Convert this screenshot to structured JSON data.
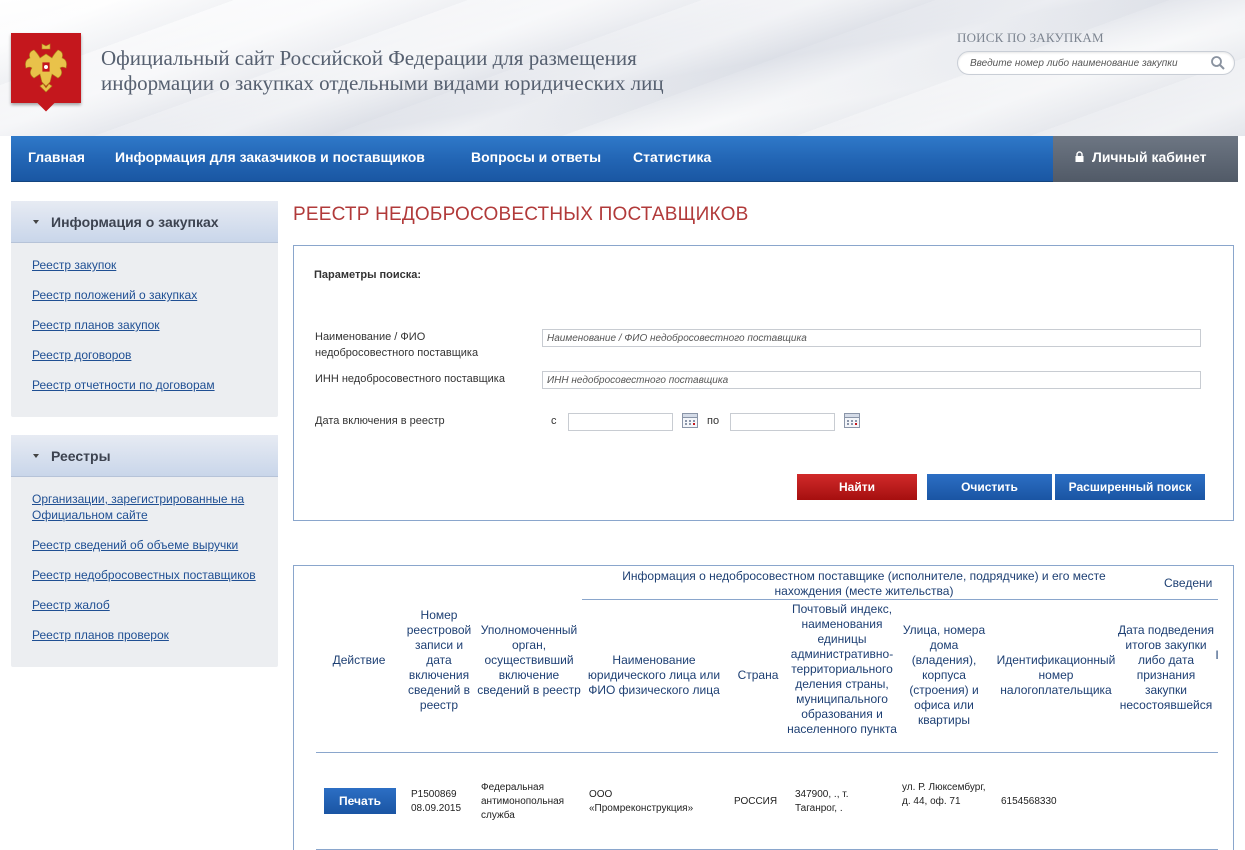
{
  "header": {
    "site_title": "Официальный сайт Российской Федерации для размещения информации о закупках отдельными видами юридических лиц",
    "search_label": "ПОИСК ПО ЗАКУПКАМ",
    "search_placeholder": "Введите номер либо наименование закупки"
  },
  "nav": {
    "items": [
      "Главная",
      "Информация для заказчиков и поставщиков",
      "Вопросы и ответы",
      "Статистика"
    ],
    "cabinet": "Личный кабинет"
  },
  "sidebar": {
    "blocks": [
      {
        "title": "Информация о закупках",
        "links": [
          "Реестр закупок",
          "Реестр положений о закупках",
          "Реестр планов закупок",
          "Реестр договоров",
          "Реестр отчетности по договорам"
        ]
      },
      {
        "title": "Реестры",
        "links": [
          "Организации, зарегистрированные на Официальном сайте",
          "Реестр сведений об объеме выручки",
          "Реестр недобросовестных поставщиков",
          "Реестр жалоб",
          "Реестр планов проверок"
        ]
      }
    ]
  },
  "main": {
    "page_title": "РЕЕСТР НЕДОБРОСОВЕСТНЫХ ПОСТАВЩИКОВ",
    "search": {
      "params_label": "Параметры поиска:",
      "name_label": "Наименование / ФИО недобросовестного поставщика",
      "name_placeholder": "Наименование / ФИО недобросовестного поставщика",
      "inn_label": "ИНН недобросовестного поставщика",
      "inn_placeholder": "ИНН недобросовестного поставщика",
      "date_label": "Дата включения в реестр",
      "from_label": "с",
      "to_label": "по",
      "find_button": "Найти",
      "clear_button": "Очистить",
      "advanced_button": "Расширенный поиск"
    },
    "table": {
      "group_header": "Информация о недобросовестном поставщике (исполнителе, подрядчике) и его месте нахождения (месте жительства)",
      "group_header_2": "Сведени",
      "columns": {
        "action": "Действие",
        "record": "Номер реестровой записи и дата включения сведений в реестр",
        "authority": "Уполномоченный орган, осуществивший включение сведений в реестр",
        "name": "Наименование юридического лица или ФИО физического лица",
        "country": "Страна",
        "postal": "Почтовый индекс, наименования единицы административно-территориального деления страны, муниципального образования и населенного пункта",
        "street": "Улица, номера дома (владения), корпуса (строения) и офиса или квартиры",
        "inn": "Идентификационный номер налогоплательщика",
        "date": "Дата подведения итогов закупки либо дата признания закупки несостоявшейся",
        "extra": "I"
      },
      "rows": [
        {
          "print": "Печать",
          "record_no": "P1500869",
          "record_date": "08.09.2015",
          "authority": "Федеральная антимонопольная служба",
          "name": "ООО «Промреконструкция»",
          "country": "РОССИЯ",
          "postal": "347900, ., т. Таганрог, .",
          "street": "ул. Р. Люксембург, д. 44, оф. 71",
          "inn": "6154568330"
        }
      ]
    }
  }
}
